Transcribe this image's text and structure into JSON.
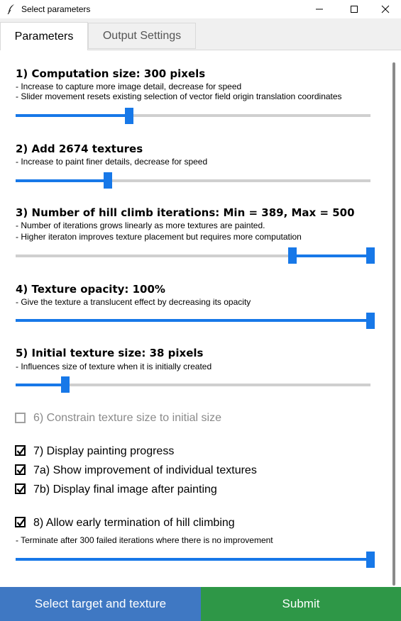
{
  "window": {
    "title": "Select parameters",
    "icons": [
      "feather-icon",
      "minimize-icon",
      "maximize-icon",
      "close-icon"
    ]
  },
  "tabs": [
    {
      "label": "Parameters",
      "active": true
    },
    {
      "label": "Output Settings",
      "active": false
    }
  ],
  "sections": {
    "s1": {
      "heading": "1) Computation size: 300 pixels",
      "desc1": "- Increase to capture more image detail, decrease for speed",
      "desc2": "- Slider movement resets existing selection of vector field origin translation coordinates",
      "slider_fraction": 0.32
    },
    "s2": {
      "heading": "2) Add 2674 textures",
      "desc1": "- Increase to paint finer details, decrease for speed",
      "slider_fraction": 0.26
    },
    "s3": {
      "heading": "3) Number of hill climb iterations: Min = 389, Max = 500",
      "desc1": "- Number of iterations grows linearly as more textures are painted.",
      "desc2": "- Higher iteraton improves texture placement but requires more computation",
      "range_low_fraction": 0.78,
      "range_high_fraction": 1.0
    },
    "s4": {
      "heading": "4) Texture opacity: 100%",
      "desc1": "- Give the texture a translucent effect by decreasing its opacity",
      "slider_fraction": 1.0
    },
    "s5": {
      "heading": "5) Initial texture size: 38 pixels",
      "desc1": "- Influences size of texture when it is initially created",
      "slider_fraction": 0.14
    },
    "s8": {
      "desc1": "- Terminate after 300 failed iterations where there is no improvement",
      "slider_fraction": 1.0
    }
  },
  "checkboxes": {
    "c6": {
      "label": "6) Constrain texture size to initial size",
      "checked": false,
      "disabled": true
    },
    "c7": {
      "label": "7) Display painting progress",
      "checked": true
    },
    "c7a": {
      "label": "7a) Show improvement of individual textures",
      "checked": true
    },
    "c7b": {
      "label": "7b) Display final image after painting",
      "checked": true
    },
    "c8": {
      "label": "8) Allow early termination of hill climbing",
      "checked": true
    }
  },
  "buttons": {
    "select_label": "Select target and texture",
    "submit_label": "Submit"
  },
  "colors": {
    "accent": "#1778e8",
    "select_button": "#3f78c3",
    "submit_button": "#2e9747"
  }
}
